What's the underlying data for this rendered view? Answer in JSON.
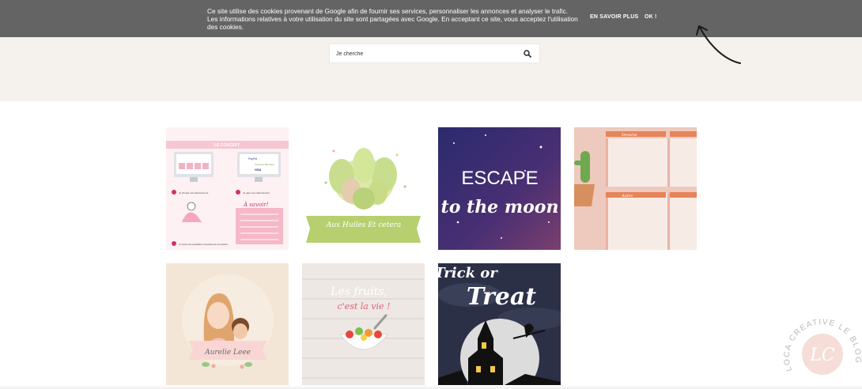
{
  "cookie_banner": {
    "message": "Ce site utilise des cookies provenant de Google afin de fournir ses services, personnaliser les annonces et analyser le trafic. Les informations relatives à votre utilisation du site sont partagées avec Google. En acceptant ce site, vous acceptez l'utilisation des cookies.",
    "learn_more_label": "EN SAVOIR PLUS",
    "ok_label": "OK !"
  },
  "search": {
    "placeholder": "Je cherche",
    "icon": "search-icon"
  },
  "gallery": {
    "tile1": {
      "title": "LE CONCEPT",
      "step1": "Je choisis mon abonnement",
      "step2": "Je paie mon abonnement",
      "step3": "Je reçois mes newsletters composées de mes articles",
      "payment_paypal": "PayPal",
      "payment_transfer": "Virement Bancaire",
      "payment_visa": "VISA",
      "know_label": "À savoir!"
    },
    "tile2": {
      "banner": "Aux Huiles Et cetera"
    },
    "tile3": {
      "line1": "ESCAPE",
      "line2": "to the moon"
    },
    "tile4": {
      "header1": "Dessins",
      "header2": "Autre"
    },
    "tile5": {
      "banner": "Aurelie Leee"
    },
    "tile6": {
      "line1": "Les fruits,",
      "line2": "c'est la vie !"
    },
    "tile7": {
      "line1": "Trick or",
      "line2": "Treat"
    }
  },
  "watermark": {
    "text": "LOCA CREATIVE LE BLOG",
    "monogram": "LC"
  },
  "colors": {
    "cookie_bar": "#646464",
    "header_band": "#f5f1ec",
    "pink": "#f4c6cf",
    "night_purple": "#3d2f6b"
  }
}
